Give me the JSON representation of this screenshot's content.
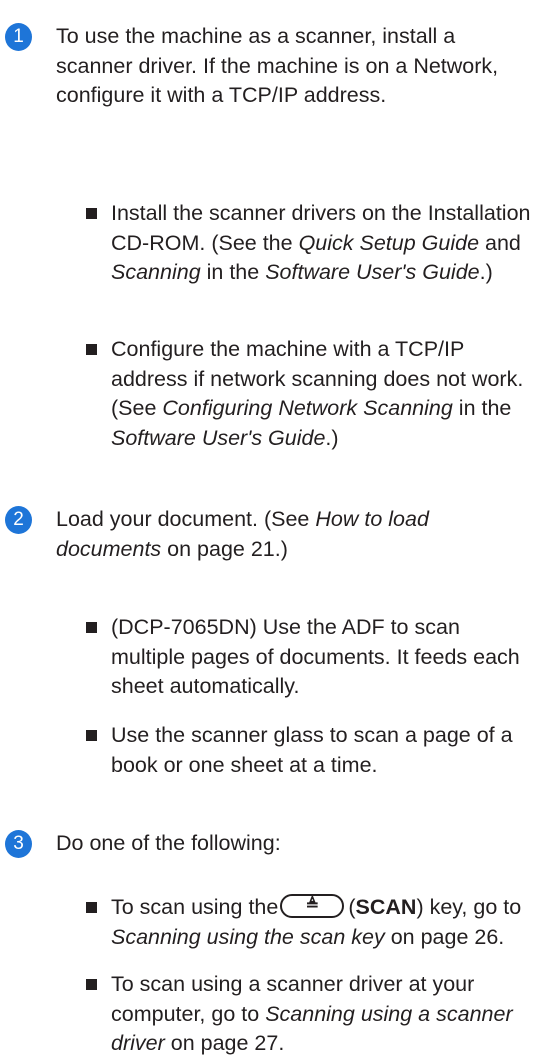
{
  "accent_color": "#1e75d8",
  "steps": [
    {
      "number": "1",
      "text": "To use the machine as a scanner, install a scanner driver. If the machine is on a Network, configure it with a TCP/IP address.",
      "bullets": [
        {
          "a": "Install the scanner drivers on the Installation CD-ROM. (See the ",
          "b": "Quick Setup Guide",
          "c": " and ",
          "d": "Scanning",
          "e": " in the ",
          "f": "Software User's Guide",
          "g": ".)"
        },
        {
          "a": "Configure the machine with a TCP/IP address if network scanning does not work. (See ",
          "b": "Configuring Network Scanning",
          "c": " in the ",
          "d": "Software User's Guide",
          "e": ".)"
        }
      ]
    },
    {
      "number": "2",
      "a": "Load your document. (See ",
      "b": "How to load documents",
      "c": " on page 21.)",
      "bullets": [
        {
          "text": "(DCP-7065DN) Use the ADF to scan multiple pages of documents. It feeds each sheet automatically."
        },
        {
          "text": "Use the scanner glass to scan a page of a book or one sheet at a time."
        }
      ]
    },
    {
      "number": "3",
      "text": "Do one of the following:",
      "bullets": [
        {
          "a": "To scan using the",
          "key_icon": "scan-key-icon",
          "b": "(",
          "c": "SCAN",
          "d": ") key, go to ",
          "e": "Scanning using the scan key",
          "f": " on page 26."
        },
        {
          "a": "To scan using a scanner driver at your computer, go to ",
          "b": "Scanning using a scanner driver",
          "c": " on page 27."
        }
      ]
    }
  ]
}
